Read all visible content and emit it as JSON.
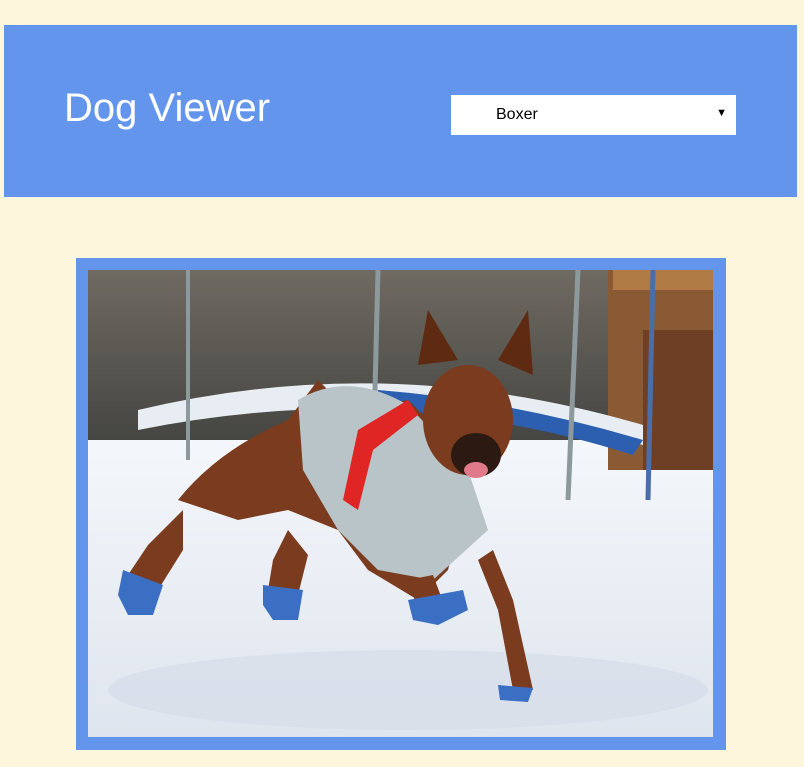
{
  "header": {
    "title": "Dog Viewer",
    "background_color": "#6495ed"
  },
  "breed_select": {
    "selected": "Boxer",
    "arrow_icon": "triangle-down-icon"
  },
  "photo": {
    "alt": "Boxer",
    "frame_color": "#6495ed"
  },
  "page": {
    "background_color": "#fdf5dc"
  }
}
